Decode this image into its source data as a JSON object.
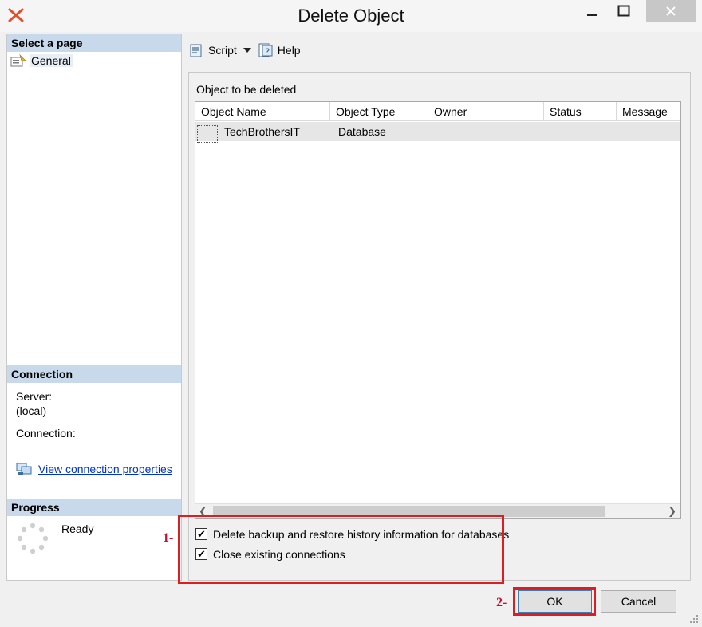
{
  "window": {
    "title": "Delete Object",
    "controls": {
      "minimize": "minimize-icon",
      "maximize": "maximize-icon",
      "close": "close-icon"
    }
  },
  "left": {
    "select_page_header": "Select a page",
    "pages": [
      {
        "label": "General",
        "icon": "page-icon",
        "selected": true
      }
    ],
    "connection_header": "Connection",
    "server_label": "Server:",
    "server_value": "(local)",
    "connection_label": "Connection:",
    "view_connection_link": "View connection properties",
    "progress_header": "Progress",
    "progress_status": "Ready"
  },
  "toolbar": {
    "script_label": "Script",
    "help_label": "Help"
  },
  "main": {
    "object_label": "Object to be deleted",
    "columns": [
      "Object Name",
      "Object Type",
      "Owner",
      "Status",
      "Message"
    ],
    "rows": [
      {
        "object_name": "TechBrothersIT",
        "object_type": "Database",
        "owner": "",
        "status": "",
        "message": ""
      }
    ]
  },
  "options": [
    {
      "label": "Delete backup and restore history information for databases",
      "checked": true
    },
    {
      "label": "Close existing connections",
      "checked": true
    }
  ],
  "buttons": {
    "ok": "OK",
    "cancel": "Cancel"
  },
  "annotations": {
    "label1": "1-",
    "label2": "2-",
    "color": "#e11b22"
  }
}
